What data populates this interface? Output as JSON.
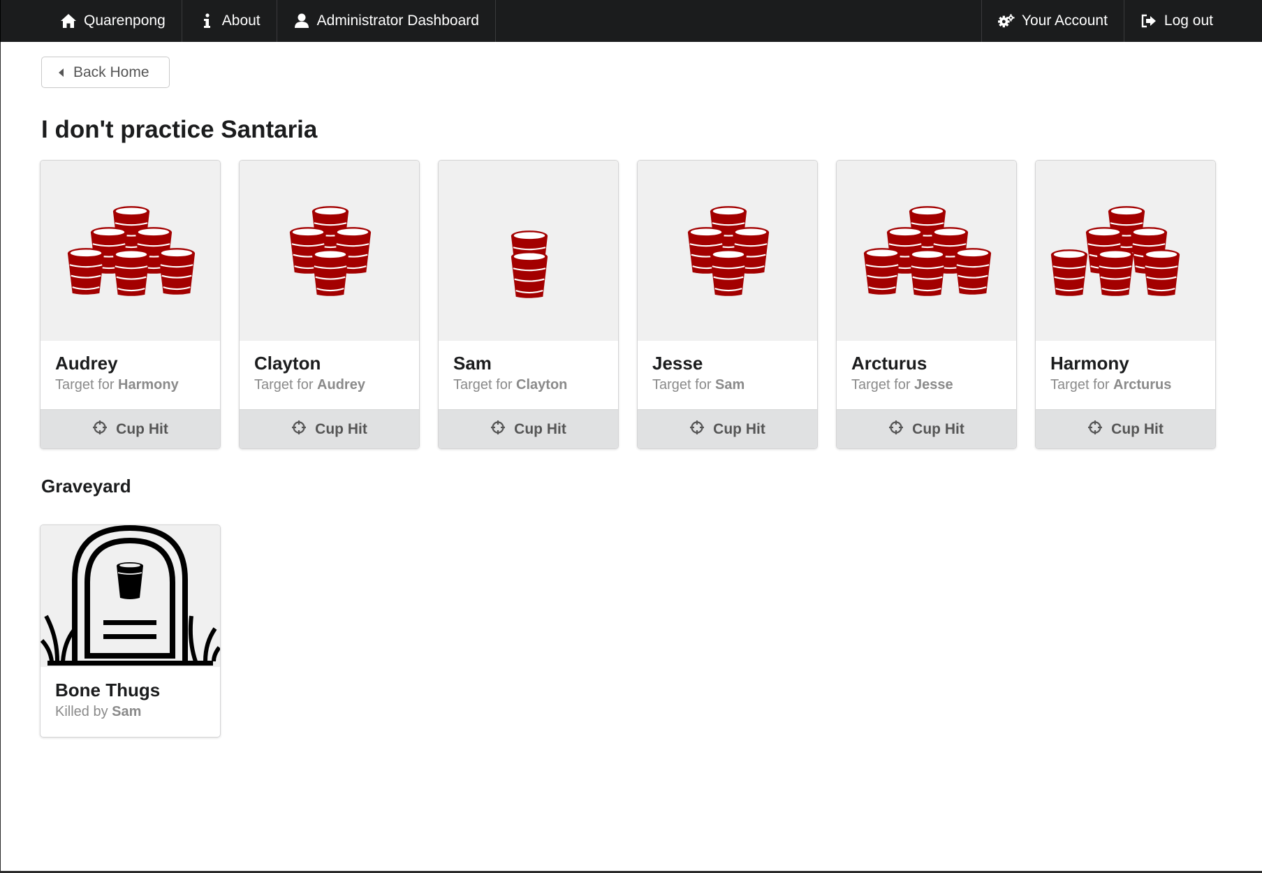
{
  "nav": {
    "home_label": "Quarenpong",
    "about_label": "About",
    "admin_label": "Administrator Dashboard",
    "account_label": "Your Account",
    "logout_label": "Log out"
  },
  "back_button": {
    "label": "Back Home"
  },
  "page_title": "I don't practice Santaria",
  "players": [
    {
      "name": "Audrey",
      "target_prefix": "Target for ",
      "target": "Harmony",
      "cups": 6,
      "button": "Cup Hit"
    },
    {
      "name": "Clayton",
      "target_prefix": "Target for ",
      "target": "Audrey",
      "cups": 4,
      "button": "Cup Hit"
    },
    {
      "name": "Sam",
      "target_prefix": "Target for ",
      "target": "Clayton",
      "cups": 2,
      "button": "Cup Hit"
    },
    {
      "name": "Jesse",
      "target_prefix": "Target for ",
      "target": "Sam",
      "cups": 4,
      "button": "Cup Hit"
    },
    {
      "name": "Arcturus",
      "target_prefix": "Target for ",
      "target": "Jesse",
      "cups": 6,
      "button": "Cup Hit"
    },
    {
      "name": "Harmony",
      "target_prefix": "Target for ",
      "target": "Arcturus",
      "cups": 8,
      "button": "Cup Hit"
    }
  ],
  "graveyard": {
    "title": "Graveyard",
    "entries": [
      {
        "name": "Bone Thugs",
        "killed_prefix": "Killed by ",
        "killer": "Sam"
      }
    ]
  },
  "colors": {
    "cup": "#a30000",
    "nav_bg": "#1b1c1d",
    "button_bg": "#e0e1e2"
  },
  "icons": {
    "home": "home-icon",
    "about": "info-icon",
    "admin": "user-icon",
    "account": "gears-icon",
    "logout": "sign-out-icon",
    "back": "caret-left-icon",
    "cup_hit": "crosshairs-icon",
    "cups": "red-cup-icon",
    "tombstone": "tombstone-icon"
  }
}
